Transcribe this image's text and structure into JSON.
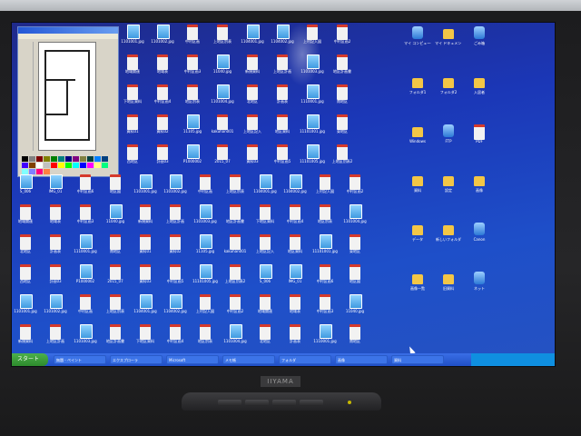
{
  "photo": {
    "subject": "LCD monitor displaying a crowded Windows XP desktop",
    "monitor_brand": "IIYAMA"
  },
  "paint_window": {
    "title": "untitled - Paint",
    "palette_colors": [
      "#000000",
      "#808080",
      "#800000",
      "#808000",
      "#008000",
      "#008080",
      "#000080",
      "#800080",
      "#808040",
      "#004040",
      "#0080ff",
      "#004080",
      "#4000ff",
      "#804000",
      "#ffffff",
      "#c0c0c0",
      "#ff0000",
      "#ffff00",
      "#00ff00",
      "#00ffff",
      "#0000ff",
      "#ff00ff",
      "#ffff80",
      "#00ff80",
      "#80ffff",
      "#8080ff",
      "#ff0080",
      "#ff8040"
    ]
  },
  "desktop": {
    "wallpaper_color": "#1f45c0",
    "icons": [
      {
        "label": "1101001.jpg",
        "kind": "img"
      },
      {
        "label": "1101002.jpg",
        "kind": "img"
      },
      {
        "label": "中村区画",
        "kind": "doc"
      },
      {
        "label": "上地区別表",
        "kind": "doc"
      },
      {
        "label": "1104001.jpg",
        "kind": "img"
      },
      {
        "label": "1104002.jpg",
        "kind": "img"
      },
      {
        "label": "上村記入図",
        "kind": "doc"
      },
      {
        "label": "中村区画2",
        "kind": "doc"
      },
      {
        "label": "地域関連",
        "kind": "doc"
      },
      {
        "label": "地域表",
        "kind": "doc"
      },
      {
        "label": "中村区画3",
        "kind": "doc"
      },
      {
        "label": "11040.jpg",
        "kind": "img"
      },
      {
        "label": "新規資料",
        "kind": "doc"
      },
      {
        "label": "上地区計画",
        "kind": "doc"
      },
      {
        "label": "1101003.jpg",
        "kind": "img"
      },
      {
        "label": "地区計画書",
        "kind": "doc"
      },
      {
        "label": "下地区資料",
        "kind": "doc"
      },
      {
        "label": "中村区画4",
        "kind": "doc"
      },
      {
        "label": "地区別表",
        "kind": "doc"
      },
      {
        "label": "1101004.jpg",
        "kind": "img"
      },
      {
        "label": "北地区",
        "kind": "doc"
      },
      {
        "label": "計画表",
        "kind": "doc"
      },
      {
        "label": "1110001.jpg",
        "kind": "img"
      },
      {
        "label": "南地区",
        "kind": "doc"
      },
      {
        "label": "資料01",
        "kind": "doc"
      },
      {
        "label": "資料02",
        "kind": "doc"
      },
      {
        "label": "11105.jpg",
        "kind": "img"
      },
      {
        "label": "kakuhan001",
        "kind": "doc"
      },
      {
        "label": "上地区記入",
        "kind": "doc"
      },
      {
        "label": "地区資料",
        "kind": "doc"
      },
      {
        "label": "11101001.jpg",
        "kind": "img"
      },
      {
        "label": "東地区",
        "kind": "doc"
      },
      {
        "label": "西地区",
        "kind": "doc"
      },
      {
        "label": "計画03",
        "kind": "doc"
      },
      {
        "label": "P1000002",
        "kind": "img"
      },
      {
        "label": "2015_07",
        "kind": "doc"
      },
      {
        "label": "資料03",
        "kind": "doc"
      },
      {
        "label": "中村区画5",
        "kind": "doc"
      },
      {
        "label": "11101005.jpg",
        "kind": "img"
      },
      {
        "label": "上地区別表2",
        "kind": "doc"
      },
      {
        "label": "S_006",
        "kind": "img"
      },
      {
        "label": "IMG_01",
        "kind": "img"
      },
      {
        "label": "中村区画6",
        "kind": "doc"
      },
      {
        "label": "地区図",
        "kind": "doc"
      }
    ],
    "right_icons": [
      {
        "label": "マイ コンピュータ",
        "kind": "sys"
      },
      {
        "label": "マイ ドキュメント",
        "kind": "folder"
      },
      {
        "label": "ごみ箱",
        "kind": "sys"
      },
      {
        "label": "フォルダ1",
        "kind": "folder"
      },
      {
        "label": "フォルダ2",
        "kind": "folder"
      },
      {
        "label": "入居者",
        "kind": "folder"
      },
      {
        "label": "Windows",
        "kind": "folder"
      },
      {
        "label": "FTP",
        "kind": "sys"
      },
      {
        "label": "PDF",
        "kind": "doc"
      },
      {
        "label": "資料",
        "kind": "folder"
      },
      {
        "label": "設定",
        "kind": "folder"
      },
      {
        "label": "画像",
        "kind": "folder"
      },
      {
        "label": "データ",
        "kind": "folder"
      },
      {
        "label": "新しいフォルダ",
        "kind": "folder"
      },
      {
        "label": "Canon",
        "kind": "sys"
      },
      {
        "label": "画像一覧",
        "kind": "folder"
      },
      {
        "label": "旧資料",
        "kind": "folder"
      },
      {
        "label": "ネット",
        "kind": "sys"
      }
    ]
  },
  "taskbar": {
    "start_label": "スタート",
    "tasks": [
      "無題 - ペイント",
      "エクスプローラ",
      "Microsoft",
      "メモ帳",
      "フォルダ",
      "画像",
      "資料"
    ]
  }
}
